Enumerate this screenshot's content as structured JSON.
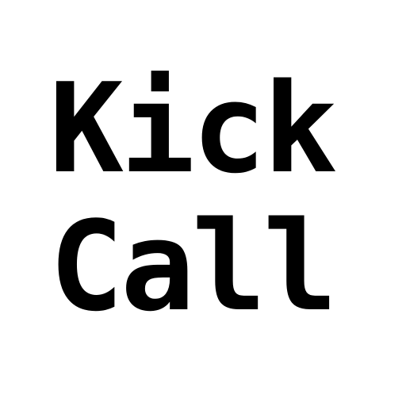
{
  "logo": {
    "lines": [
      "Kick",
      "Call"
    ],
    "text_color": "#000000",
    "background_color": "#ffffff"
  }
}
